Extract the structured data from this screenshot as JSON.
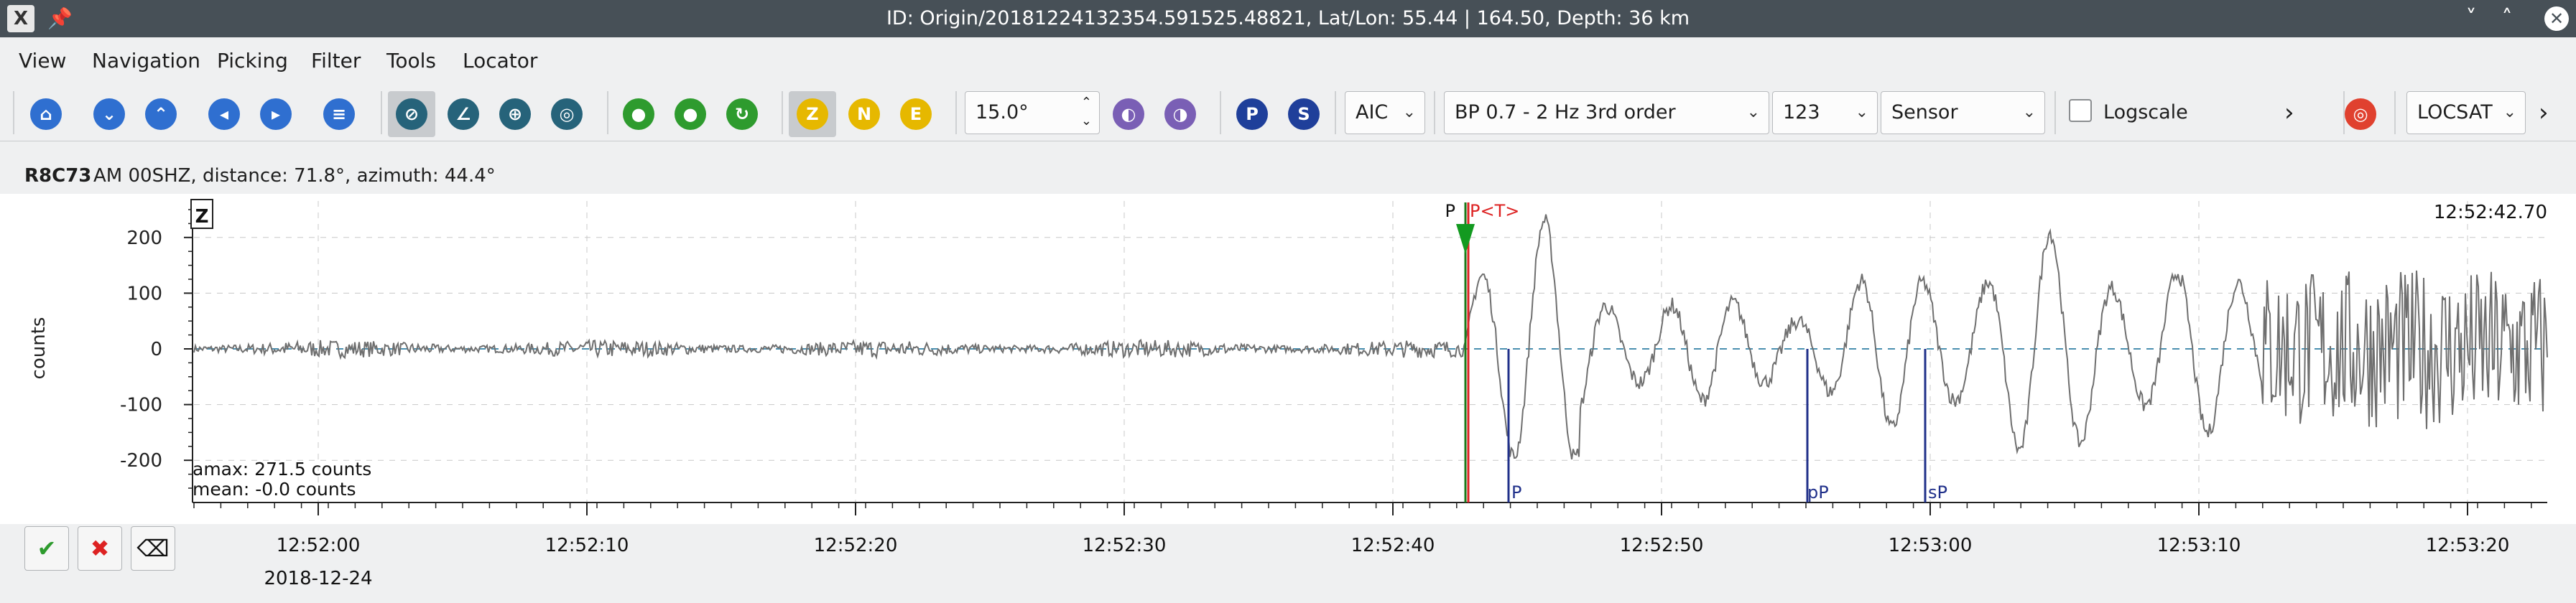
{
  "window": {
    "title": "ID: Origin/20181224132354.591525.48821, Lat/Lon: 55.44 | 164.50, Depth: 36 km",
    "app_icon": "X",
    "pin_icon": "pin-icon",
    "minimize_glyph": "˅",
    "maximize_glyph": "˄",
    "close_glyph": "✕"
  },
  "menu": [
    "View",
    "Navigation",
    "Picking",
    "Filter",
    "Tools",
    "Locator"
  ],
  "toolbar": {
    "z_label": "Z",
    "n_label": "N",
    "e_label": "E",
    "p_label": "P",
    "s_label": "S",
    "angle_value": "15.0°",
    "picker_method": "AIC",
    "filter": "BP 0.7 - 2 Hz  3rd order",
    "components": "123",
    "unit": "Sensor",
    "logscale_label": "Logscale",
    "more_glyph": "›",
    "locator": "LOCSAT",
    "colors": {
      "nav_blue": "#2f6fd0",
      "pick_green": "#2e9b2e",
      "comp_yellow": "#e6b800",
      "ps_blue": "#1f3f9a",
      "target_red": "#e0412f"
    }
  },
  "trace_info": {
    "station": "R8C73",
    "details": "AM  00SHZ, distance: 71.8°, azimuth: 44.4°"
  },
  "plot": {
    "component_label": "Z",
    "y_axis_label": "counts",
    "y_ticks": [
      "200",
      "100",
      "0",
      "-100",
      "-200"
    ],
    "end_time_label": "12:52:42.70",
    "amax_text": "amax: 271.5 counts",
    "mean_text": "mean: -0.0 counts",
    "pick_labels": {
      "p_manual": "P",
      "p_theo": "P<T>",
      "p_arrival": "P",
      "pp_arrival": "pP",
      "sp_arrival": "sP"
    },
    "time_ticks": [
      "12:52:00",
      "12:52:10",
      "12:52:20",
      "12:52:30",
      "12:52:40",
      "12:52:50",
      "12:53:00",
      "12:53:10",
      "12:53:20"
    ],
    "date_label": "2018-12-24"
  },
  "actions": {
    "accept_icon": "check-icon",
    "reject_icon": "cancel-icon",
    "clear_icon": "clear-icon"
  }
}
